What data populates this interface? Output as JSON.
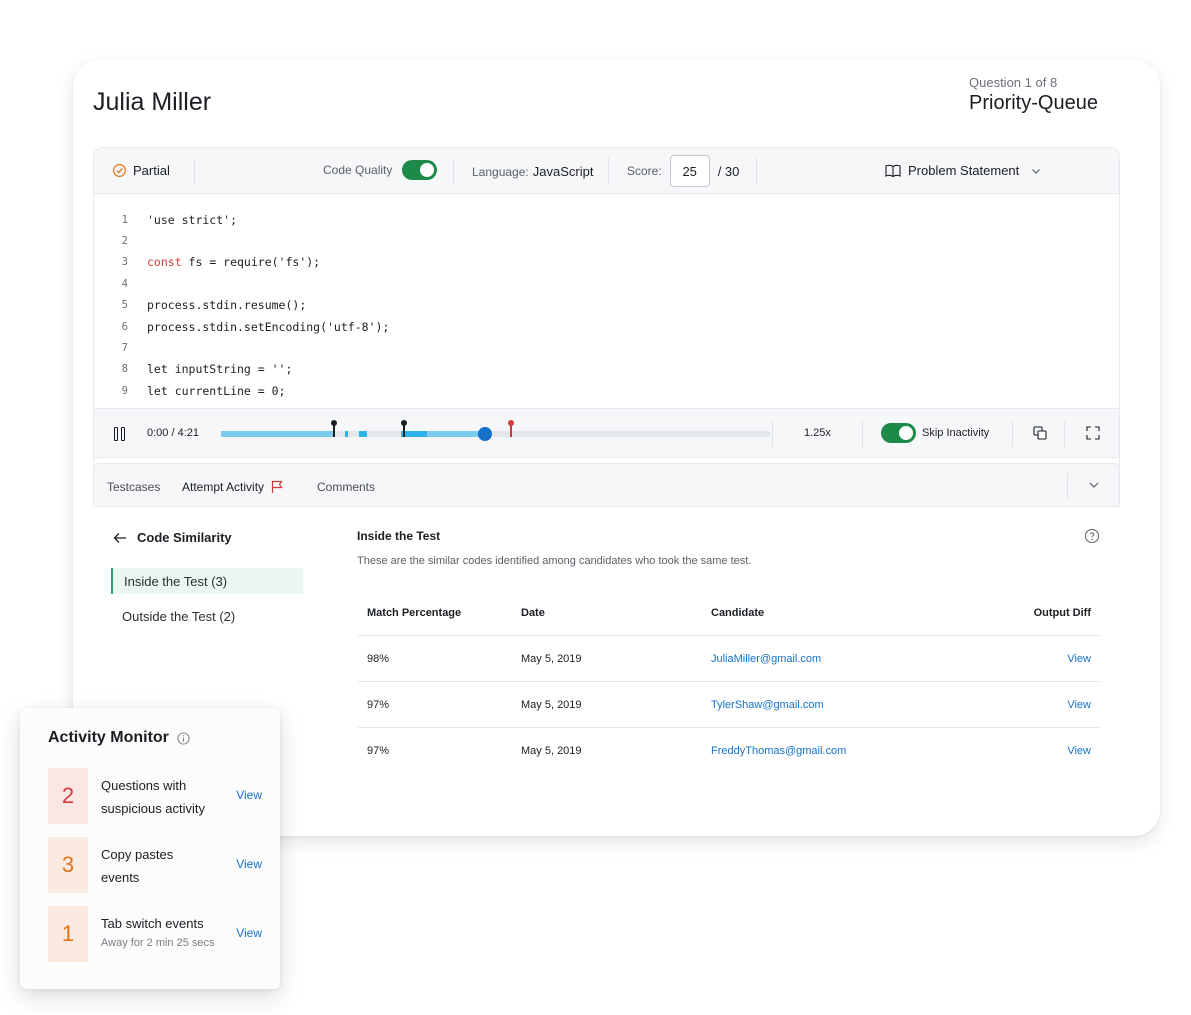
{
  "candidate": {
    "name": "Julia Miller"
  },
  "question": {
    "meta": "Question 1 of 8",
    "title": "Priority-Queue"
  },
  "toolbar": {
    "status": "Partial",
    "code_quality_label": "Code Quality",
    "code_quality_on": true,
    "language_label": "Language:",
    "language_value": "JavaScript",
    "score_label": "Score:",
    "score_value": "25",
    "score_total": "/ 30",
    "problem_statement": "Problem Statement"
  },
  "code": {
    "lines": [
      {
        "n": "1",
        "text": "'use strict';"
      },
      {
        "n": "2",
        "text": ""
      },
      {
        "n": "3",
        "kw": "const",
        "text": " fs = require('fs');"
      },
      {
        "n": "4",
        "text": ""
      },
      {
        "n": "5",
        "text": "process.stdin.resume();"
      },
      {
        "n": "6",
        "text": "process.stdin.setEncoding('utf-8');"
      },
      {
        "n": "7",
        "text": ""
      },
      {
        "n": "8",
        "text": "let inputString = '';"
      },
      {
        "n": "9",
        "text": "let currentLine = 0;"
      }
    ]
  },
  "player": {
    "time": "0:00 / 4:21",
    "progress": 0.48,
    "speed": "1.25x",
    "skip_inactivity_label": "Skip Inactivity",
    "skip_inactivity_on": true
  },
  "tabs": {
    "testcases": "Testcases",
    "attempt_activity": "Attempt Activity",
    "comments": "Comments"
  },
  "similarity": {
    "title": "Code Similarity",
    "inside": "Inside the Test (3)",
    "outside": "Outside the Test (2)",
    "section_title": "Inside the Test",
    "section_desc": "These are the similar codes identified among candidates who took the same test.",
    "headers": [
      "Match Percentage",
      "Date",
      "Candidate",
      "Output Diff"
    ],
    "rows": [
      {
        "match": "98%",
        "date": "May 5, 2019",
        "candidate": "JuliaMiller@gmail.com",
        "diff": "View"
      },
      {
        "match": "97%",
        "date": "May 5, 2019",
        "candidate": "TylerShaw@gmail.com",
        "diff": "View"
      },
      {
        "match": "97%",
        "date": "May 5, 2019",
        "candidate": "FreddyThomas@gmail.com",
        "diff": "View"
      }
    ]
  },
  "monitor": {
    "title": "Activity Monitor",
    "items": [
      {
        "count": "2",
        "line1": "Questions with",
        "line2": "suspicious activity",
        "sub": "",
        "view": "View"
      },
      {
        "count": "3",
        "line1": "Copy pastes",
        "line2": "events",
        "sub": "",
        "view": "View"
      },
      {
        "count": "1",
        "line1": "Tab switch events",
        "line2": "",
        "sub": "Away for 2 min 25 secs",
        "view": "View"
      }
    ]
  },
  "colors": {
    "accent_blue": "#1672c9",
    "toggle_green": "#1e8a4a",
    "flag_red": "#d23b3b",
    "partial_orange": "#e1741a"
  }
}
